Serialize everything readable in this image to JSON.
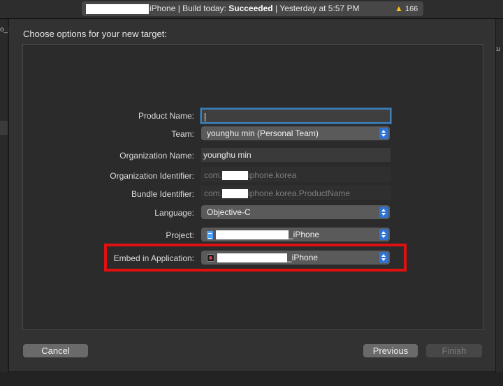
{
  "toolbar": {
    "status_scheme": "iPhone",
    "status_build": "| Build today:",
    "status_result": "Succeeded",
    "status_time": "| Yesterday at 5:57 PM",
    "warning_count": "166",
    "left_fragment": "o_i",
    "right_fragment": "tu"
  },
  "sheet": {
    "title": "Choose options for your new target:",
    "fields": {
      "product_name": {
        "label": "Product Name:",
        "value": ""
      },
      "team": {
        "label": "Team:",
        "value": "younghu min (Personal Team)"
      },
      "organization_name": {
        "label": "Organization Name:",
        "value": "younghu min"
      },
      "organization_identifier": {
        "label": "Organization Identifier:",
        "prefix": "com.",
        "suffix": "iphone.korea"
      },
      "bundle_identifier": {
        "label": "Bundle Identifier:",
        "prefix": "com.",
        "suffix": "iphone.korea.ProductName"
      },
      "language": {
        "label": "Language:",
        "value": "Objective-C"
      },
      "project": {
        "label": "Project:",
        "suffix": "_iPhone"
      },
      "embed_in_application": {
        "label": "Embed in Application:",
        "suffix": "_iPhone"
      }
    },
    "buttons": {
      "cancel": "Cancel",
      "previous": "Previous",
      "finish": "Finish"
    }
  },
  "colors": {
    "focus_ring": "#3d7fb8",
    "popup_stepper": "#2f73d6",
    "annotation_box": "#e01010",
    "warning": "#f5c518"
  },
  "icons": [
    "warning-icon",
    "document-icon",
    "app-icon",
    "chevron-updown-icon"
  ]
}
